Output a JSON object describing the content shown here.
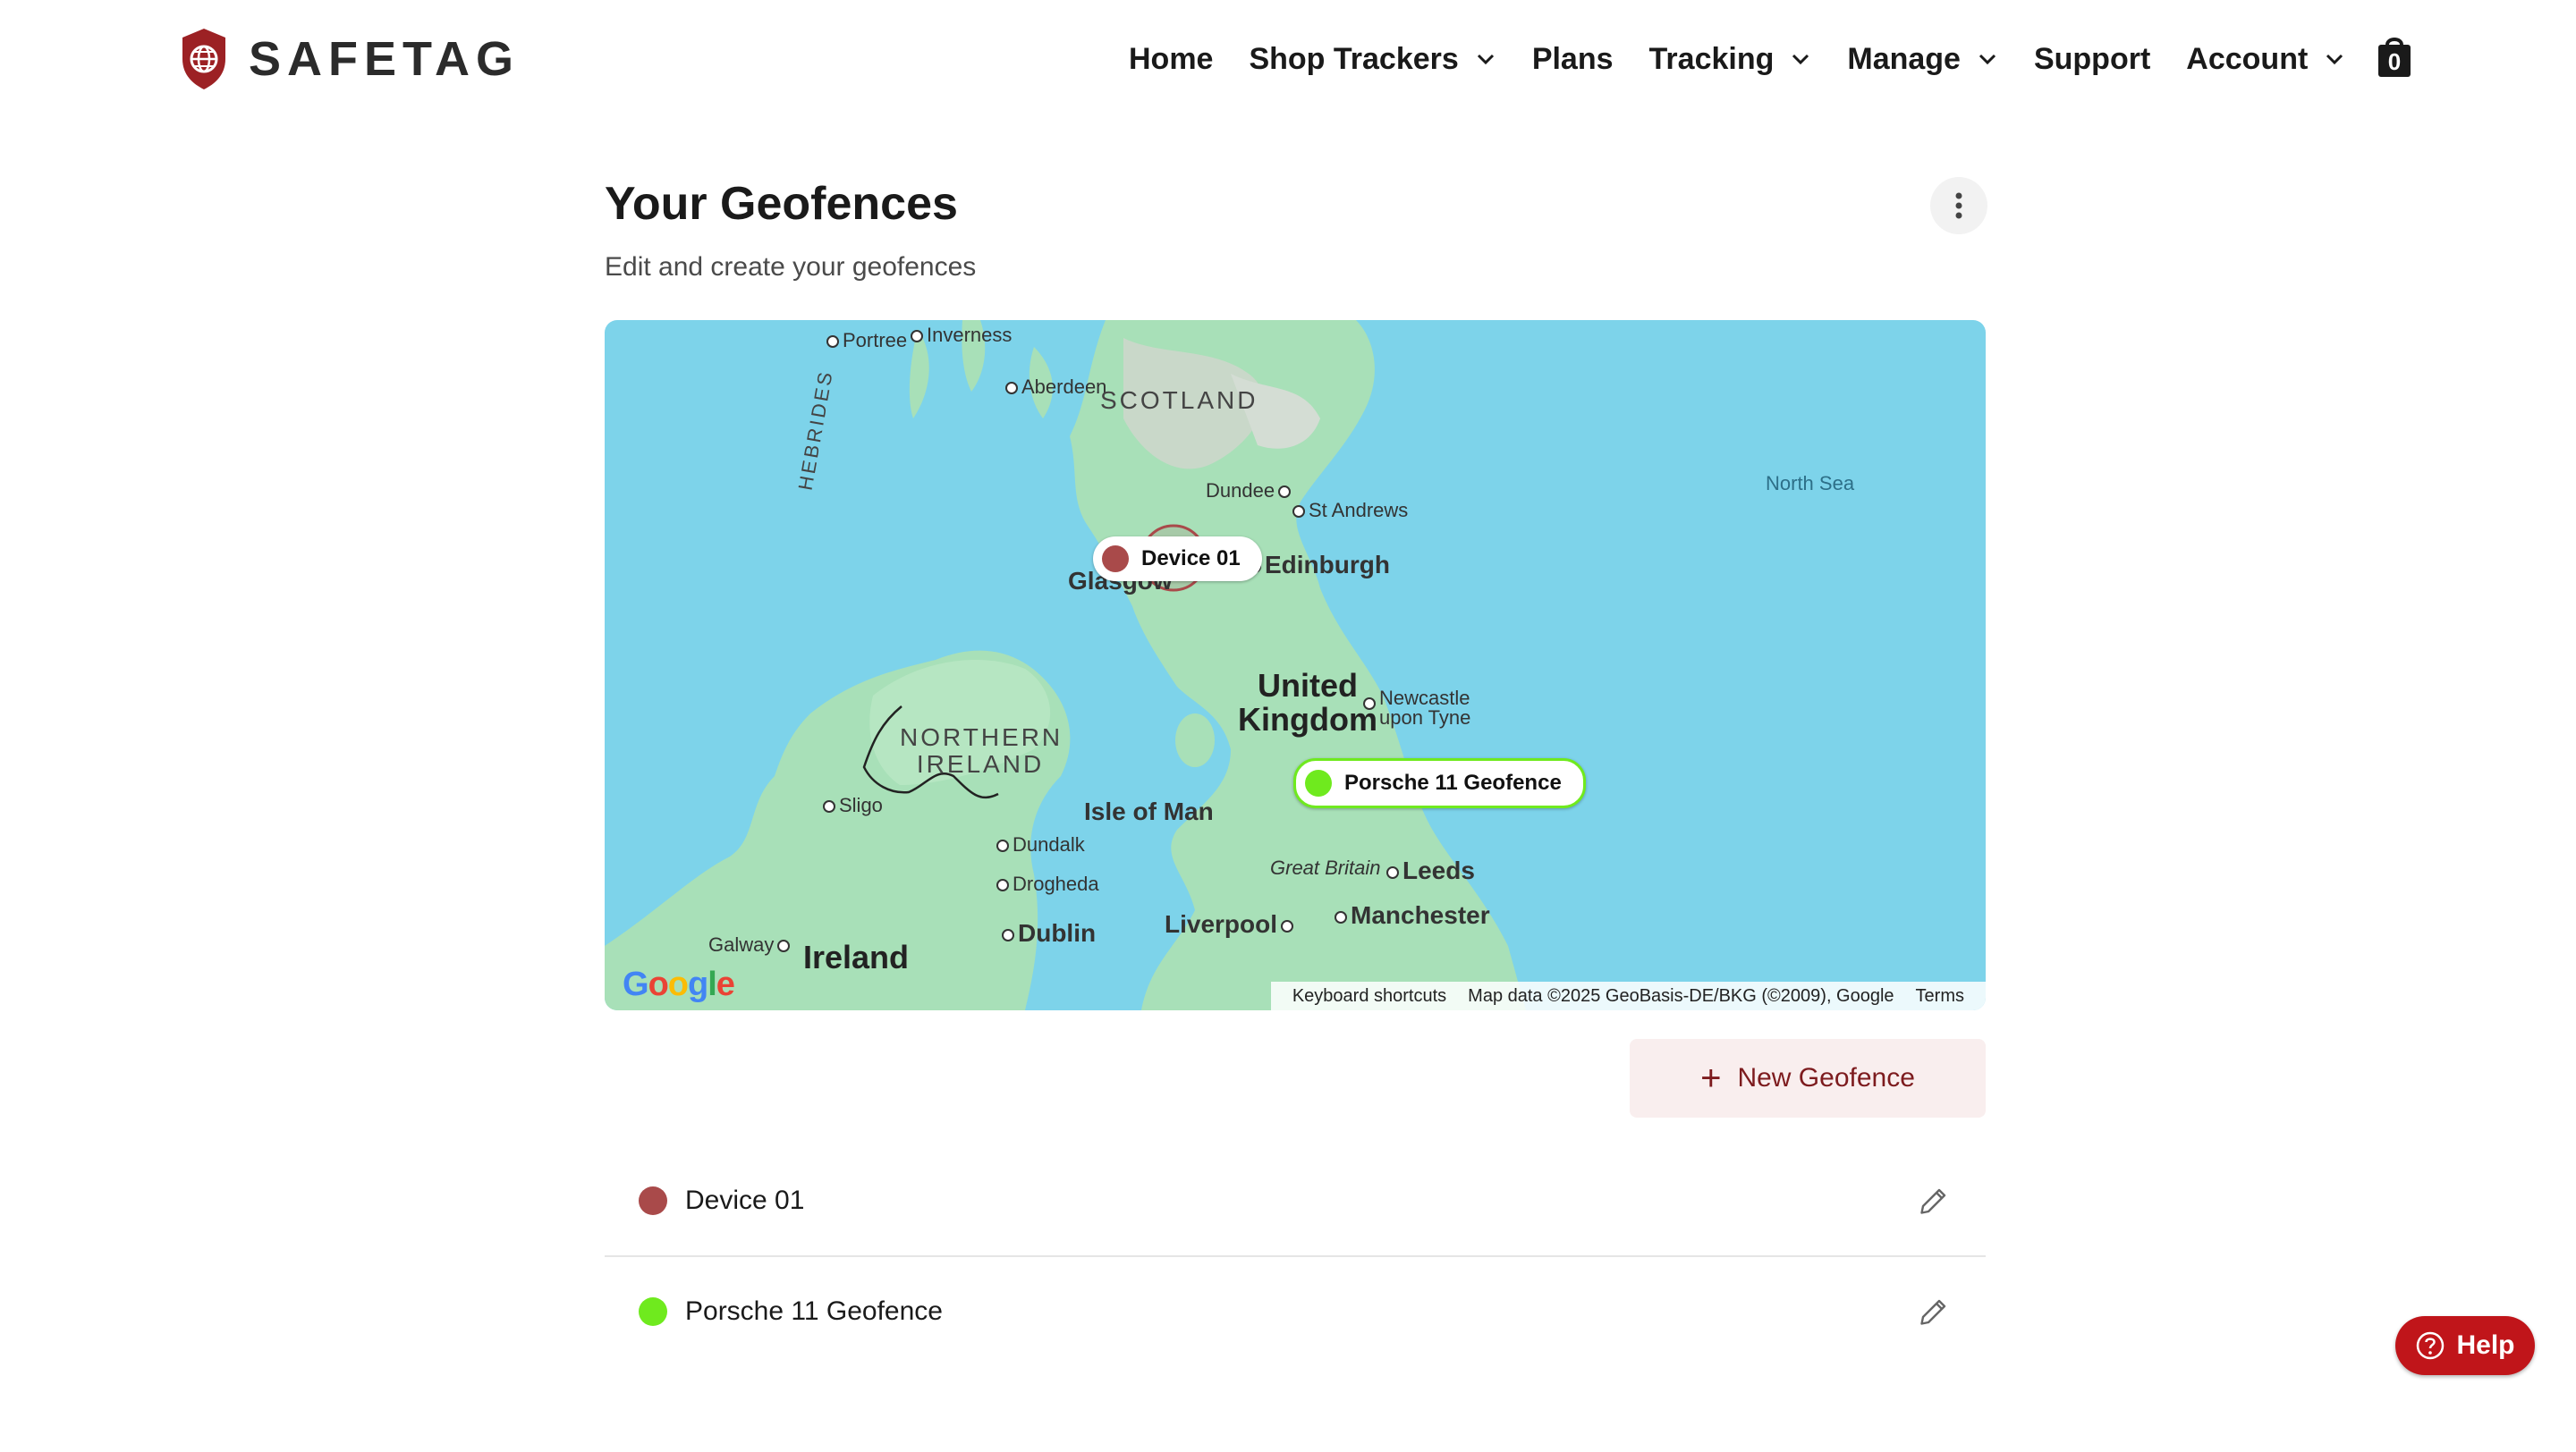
{
  "brand": {
    "name": "SAFETAG",
    "accent": "#9c2124"
  },
  "nav": {
    "items": [
      {
        "label": "Home",
        "has_chevron": false
      },
      {
        "label": "Shop Trackers",
        "has_chevron": true
      },
      {
        "label": "Plans",
        "has_chevron": false
      },
      {
        "label": "Tracking",
        "has_chevron": true
      },
      {
        "label": "Manage",
        "has_chevron": true
      },
      {
        "label": "Support",
        "has_chevron": false
      },
      {
        "label": "Account",
        "has_chevron": true
      }
    ],
    "cart_count": "0"
  },
  "page": {
    "title": "Your Geofences",
    "subtitle": "Edit and create your geofences"
  },
  "map": {
    "labels": {
      "portree": "Portree",
      "inverness": "Inverness",
      "aberdeen": "Aberdeen",
      "scotland": "SCOTLAND",
      "hebrides": "HEBRIDES",
      "dundee": "Dundee",
      "st_andrews": "St Andrews",
      "north_sea": "North Sea",
      "glasgow": "Glasgow",
      "edinburgh": "Edinburgh",
      "united_kingdom": "United Kingdom",
      "newcastle": "Newcastle upon Tyne",
      "northern_ireland": "NORTHERN IRELAND",
      "sligo": "Sligo",
      "isle_of_man": "Isle of Man",
      "dundalk": "Dundalk",
      "drogheda": "Drogheda",
      "great_britain": "Great Britain",
      "leeds": "Leeds",
      "manchester": "Manchester",
      "liverpool": "Liverpool",
      "dublin": "Dublin",
      "galway": "Galway",
      "ireland": "Ireland"
    },
    "markers": [
      {
        "label": "Device 01",
        "color": "#a94a4a"
      },
      {
        "label": "Porsche 11 Geofence",
        "color": "#6fea1e"
      }
    ],
    "attribution": {
      "shortcuts": "Keyboard shortcuts",
      "data": "Map data ©2025 GeoBasis-DE/BKG (©2009), Google",
      "terms": "Terms"
    },
    "provider": "Google"
  },
  "new_geofence_label": "New Geofence",
  "geofences": [
    {
      "label": "Device 01",
      "color": "#a94a4a"
    },
    {
      "label": "Porsche 11 Geofence",
      "color": "#6fea1e"
    }
  ],
  "help_label": "Help"
}
